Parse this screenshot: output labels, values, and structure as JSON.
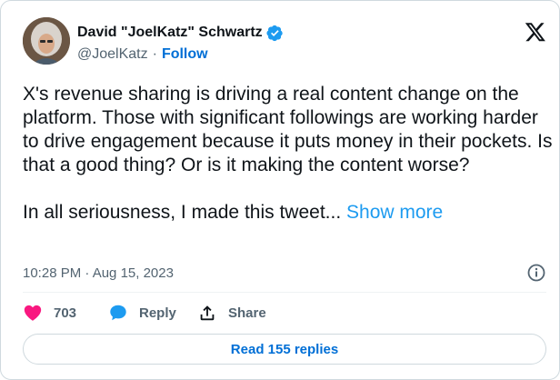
{
  "author": {
    "display_name": "David \"JoelKatz\" Schwartz",
    "handle": "@JoelKatz",
    "separator": "·",
    "follow_label": "Follow",
    "verified": true
  },
  "tweet": {
    "text": "X's revenue sharing is driving a real content change on the platform. Those with significant followings are working harder to drive engagement because it puts money in their pockets. Is that a good thing? Or is it making the content worse?\n\nIn all seriousness, I made this tweet...",
    "show_more_label": "Show more",
    "timestamp": "10:28 PM · Aug 15, 2023"
  },
  "actions": {
    "like_count": "703",
    "reply_label": "Reply",
    "share_label": "Share"
  },
  "read_replies_label": "Read 155 replies",
  "colors": {
    "like": "#f91880",
    "reply": "#1d9bf0",
    "link": "#006fd6",
    "verified": "#1d9bf0",
    "muted": "#536471"
  },
  "icons": {
    "verified": "verified-badge-icon",
    "brand": "x-logo-icon",
    "info": "info-icon",
    "like": "heart-icon",
    "reply": "speech-bubble-icon",
    "share": "share-upload-icon"
  }
}
